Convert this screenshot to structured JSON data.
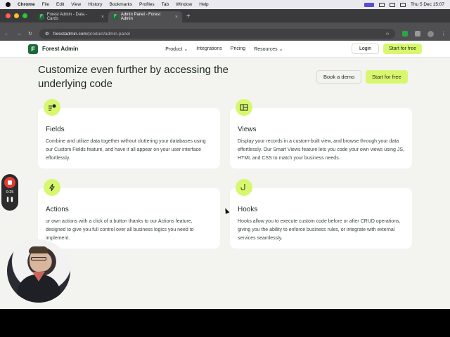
{
  "menubar": {
    "app": "Chrome",
    "items": [
      "File",
      "Edit",
      "View",
      "History",
      "Bookmarks",
      "Profiles",
      "Tab",
      "Window",
      "Help"
    ],
    "clock": "Thu 5 Dec  15:07"
  },
  "tabs": [
    {
      "title": "Forest Admin - Data - Cards"
    },
    {
      "title": "Admin Panel - Forest Admin"
    }
  ],
  "address": {
    "domain": "forestadmin.com",
    "path": "/product/admin-panel"
  },
  "site": {
    "brand": "Forest Admin",
    "nav": [
      "Product ⌄",
      "Integrations",
      "Pricing",
      "Resources ⌄"
    ],
    "login": "Login",
    "start": "Start for free"
  },
  "hero": {
    "headline": "Customize even further by accessing the underlying code",
    "demo": "Book a demo",
    "start": "Start for free"
  },
  "cards": [
    {
      "title": "Fields",
      "desc": "Combine and utilize data together without cluttering your databases using our Custom Fields feature, and have it all appear on your user interface effortlessly.",
      "icon": "fields-icon"
    },
    {
      "title": "Views",
      "desc": "Display your records in a custom-built view, and browse through your data effortlessly. Our Smart Views feature lets you code your own views using JS, HTML and CSS to match your business needs.",
      "icon": "views-icon"
    },
    {
      "title": "Actions",
      "desc": "ur own actions with a click of a button thanks to our Actions feature, designed to give you full control over all business logics you need to implement.",
      "icon": "lightning-icon"
    },
    {
      "title": "Hooks",
      "desc": "Hooks allow you to execute custom code before or after CRUD operations, giving you the ability to enforce business rules, or integrate with external services seamlessly.",
      "icon": "hook-icon"
    }
  ],
  "recording": {
    "time": "0:25"
  },
  "colors": {
    "accent": "#d9f76e",
    "brand": "#1a6b3a",
    "page_bg": "#f3f3ef"
  }
}
